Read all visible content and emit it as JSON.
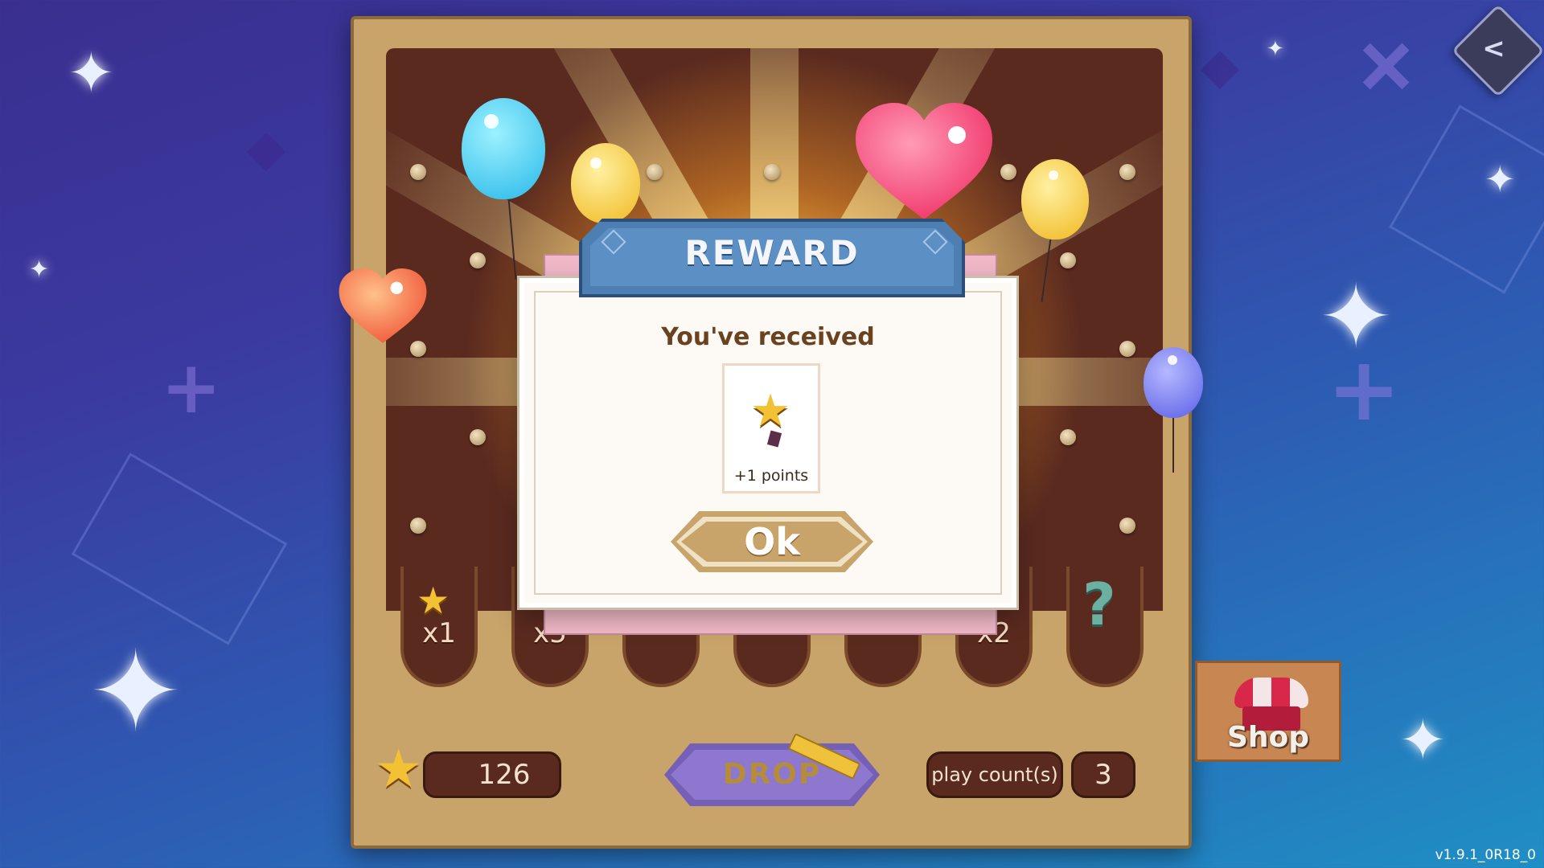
{
  "modal": {
    "title": "REWARD",
    "subtitle": "You've received",
    "reward_text": "+1 points",
    "ok_label": "Ok"
  },
  "slots": [
    {
      "label": "x1",
      "icon": "star-icon"
    },
    {
      "label": "x5",
      "icon": "none"
    },
    {
      "label": "",
      "icon": "none"
    },
    {
      "label": "",
      "icon": "none"
    },
    {
      "label": "",
      "icon": "none"
    },
    {
      "label": "x2",
      "icon": "none"
    },
    {
      "label": "",
      "icon": "question-icon"
    }
  ],
  "bottom_bar": {
    "points": "126",
    "drop_label": "DROP",
    "play_count_label": "play count(s)",
    "play_count_value": "3"
  },
  "shop": {
    "label": "Shop"
  },
  "version": "v1.9.1_0R18_0",
  "colors": {
    "background_top": "#3a2f8f",
    "background_bottom": "#1f8fc4",
    "cabinet": "#c8a46a",
    "board": "#5a2a1f",
    "title_bar": "#4e7fb2",
    "drop_button": "#7560b8",
    "shop_awning": "#d8284a"
  }
}
